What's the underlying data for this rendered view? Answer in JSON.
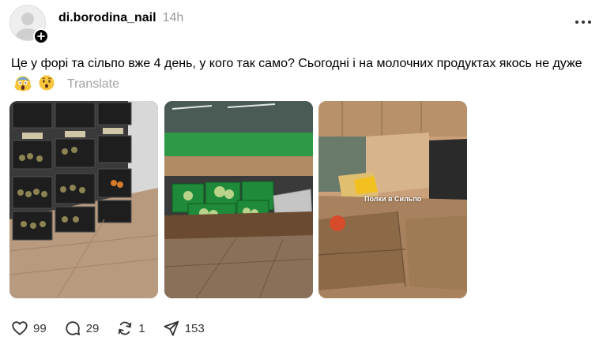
{
  "post": {
    "username": "di.borodina_nail",
    "time_ago": "14h",
    "text": "Це у форі та сільпо вже 4 день, у кого так само? Сьогодні і на молочних продуктах якось не дуже",
    "translate_label": "Translate",
    "emojis": [
      "screaming-face-emoji",
      "hushed-face-emoji"
    ],
    "media_overlay_caption": "Полки в Сильпо"
  },
  "actions": {
    "likes": "99",
    "replies": "29",
    "reposts": "1",
    "shares": "153"
  },
  "icons": {
    "avatar": "default-avatar-icon",
    "follow": "plus-icon",
    "more": "more-horizontal-icon",
    "like": "heart-icon",
    "reply": "comment-bubble-icon",
    "repost": "repost-icon",
    "share": "send-icon"
  },
  "colors": {
    "text": "#000000",
    "muted": "#999999",
    "translate": "#a3a3a3",
    "accent_green": "#1f8a3a"
  }
}
